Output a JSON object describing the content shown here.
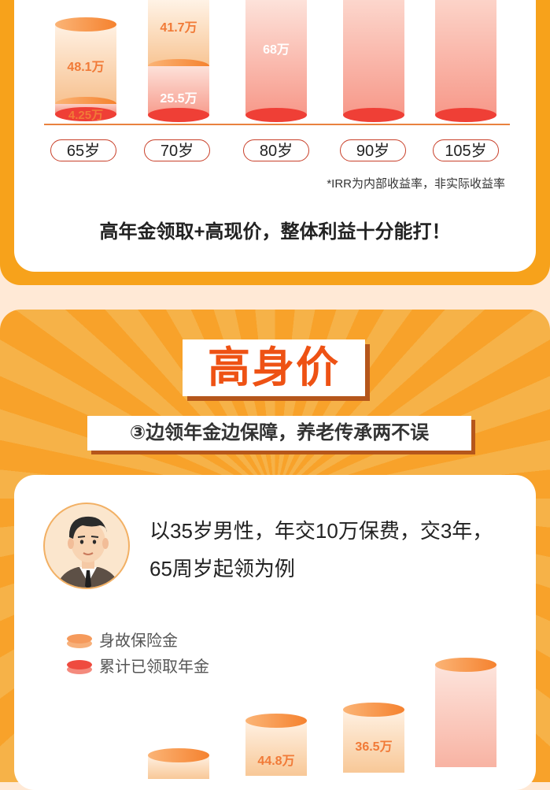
{
  "top_chart": {
    "bars": [
      {
        "age": "65岁",
        "labels": [
          "48.1万",
          "4.25万"
        ]
      },
      {
        "age": "70岁",
        "labels": [
          "41.7万",
          "25.5万"
        ]
      },
      {
        "age": "80岁",
        "labels": [
          "68万"
        ]
      },
      {
        "age": "90岁",
        "labels": []
      },
      {
        "age": "105岁",
        "labels": []
      }
    ],
    "note": "*IRR为内部收益率，非实际收益率",
    "summary": "高年金领取+高现价，整体利益十分能打！"
  },
  "section": {
    "title": "高身价",
    "subtitle": "③边领年金边保障，养老传承两不误"
  },
  "example": {
    "intro_line1": "以35岁男性，年交10万保费，交3年，",
    "intro_line2": "65周岁起领为例"
  },
  "legend": {
    "death_benefit": "身故保险金",
    "annuity_total": "累计已领取年金"
  },
  "bottom_chart": {
    "labels": [
      "44.8万",
      "36.5万"
    ]
  },
  "colors": {
    "orange": "#f7a21b",
    "accent_red": "#ee5214",
    "bar_orange": "#f59a5c",
    "bar_red": "#ef4b3f"
  }
}
